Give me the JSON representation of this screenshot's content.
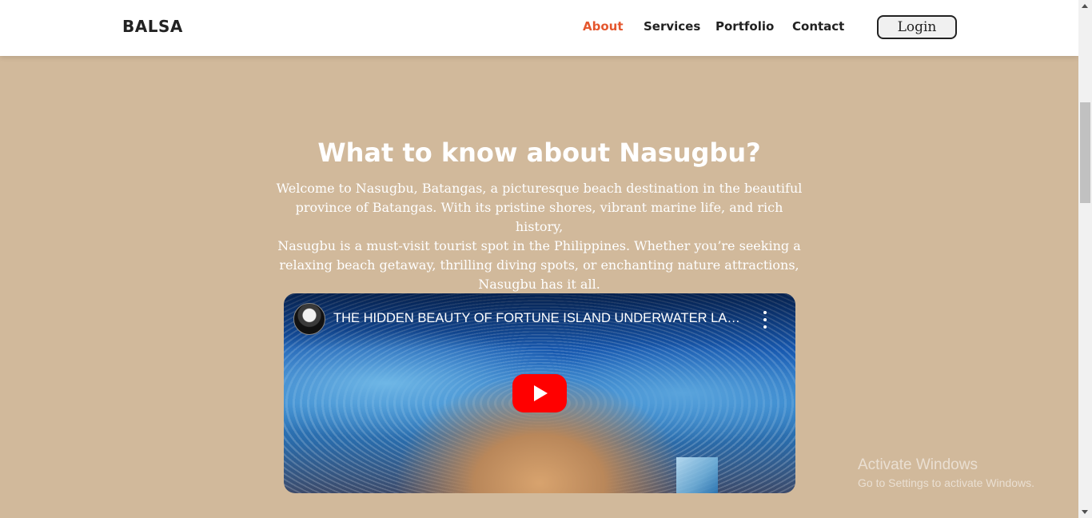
{
  "header": {
    "brand": "BALSA",
    "nav": [
      {
        "label": "About",
        "active": true
      },
      {
        "label": "Services",
        "active": false
      },
      {
        "label": "Portfolio",
        "active": false
      },
      {
        "label": "Contact",
        "active": false
      }
    ],
    "login_label": "Login"
  },
  "main": {
    "title": "What to know about Nasugbu?",
    "intro_lines": [
      "Welcome to Nasugbu, Batangas, a picturesque beach destination in the beautiful",
      "province of Batangas. With its pristine shores, vibrant marine life, and rich history,",
      "Nasugbu is a must-visit tourist spot in the Philippines. Whether you’re seeking a",
      "relaxing beach getaway, thrilling diving spots, or enchanting nature attractions,",
      "Nasugbu has it all."
    ],
    "video": {
      "title": "THE HIDDEN BEAUTY OF FORTUNE ISLAND UNDERWATER LA…",
      "play_icon": "play-icon",
      "more_icon": "more-vertical-icon"
    }
  },
  "watermark": {
    "title": "Activate Windows",
    "subtitle": "Go to Settings to activate Windows."
  },
  "colors": {
    "background": "#d1b99b",
    "accent": "#e4572e",
    "header_bg": "#ffffff",
    "play_red": "#ff0000"
  }
}
